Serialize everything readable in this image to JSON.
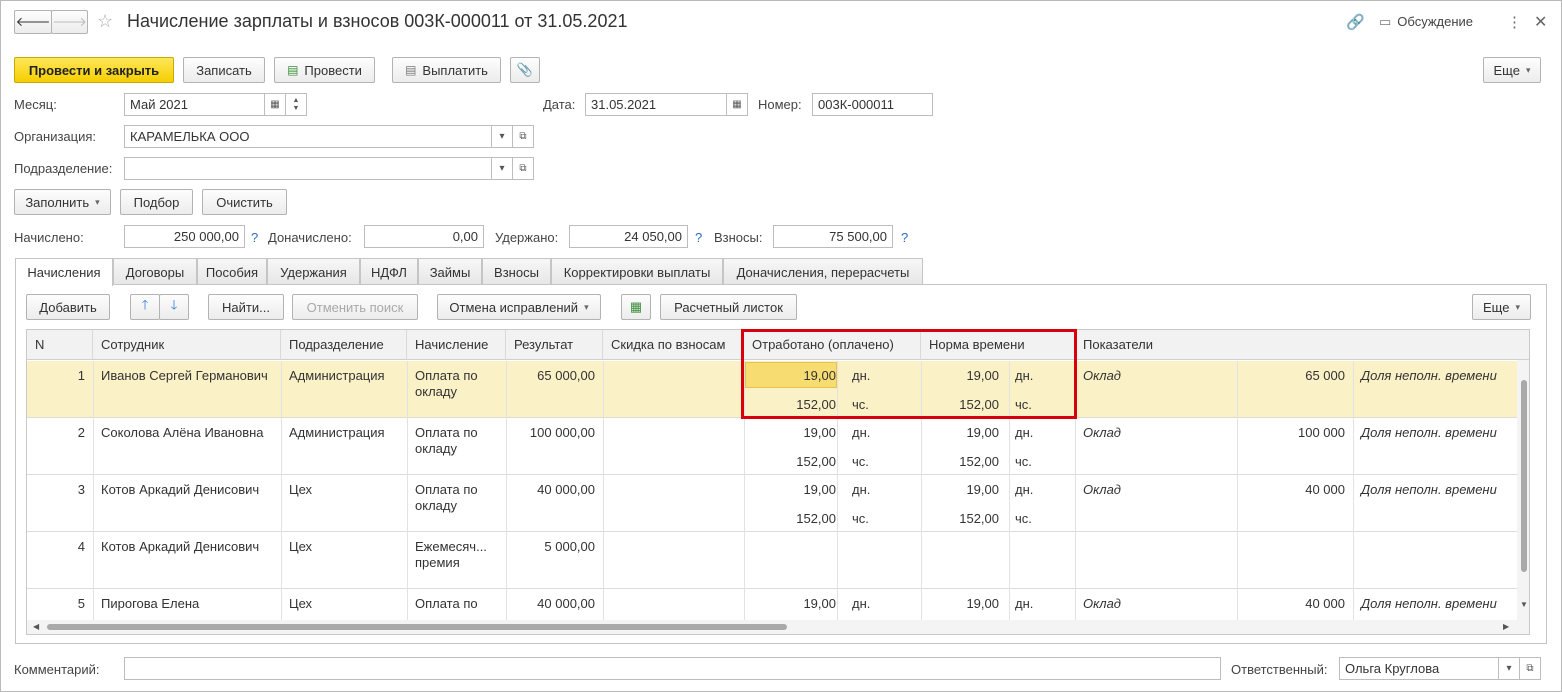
{
  "title": "Начисление зарплаты и взносов 003К-000011 от 31.05.2021",
  "window": {
    "discussion": "Обсуждение"
  },
  "toolbar": {
    "post_close": "Провести и закрыть",
    "save": "Записать",
    "post": "Провести",
    "pay": "Выплатить",
    "more": "Еще"
  },
  "header": {
    "month_label": "Месяц:",
    "month_value": "Май 2021",
    "date_label": "Дата:",
    "date_value": "31.05.2021",
    "number_label": "Номер:",
    "number_value": "003К-000011",
    "org_label": "Организация:",
    "org_value": "КАРАМЕЛЬКА ООО",
    "dept_label": "Подразделение:",
    "dept_value": ""
  },
  "actions": {
    "fill": "Заполнить",
    "select": "Подбор",
    "clear": "Очистить"
  },
  "totals": {
    "accrued_label": "Начислено:",
    "accrued_value": "250 000,00",
    "extra_label": "Доначислено:",
    "extra_value": "0,00",
    "withheld_label": "Удержано:",
    "withheld_value": "24 050,00",
    "contrib_label": "Взносы:",
    "contrib_value": "75 500,00",
    "help": "?"
  },
  "tabs": [
    "Начисления",
    "Договоры",
    "Пособия",
    "Удержания",
    "НДФЛ",
    "Займы",
    "Взносы",
    "Корректировки выплаты",
    "Доначисления, перерасчеты"
  ],
  "grid_toolbar": {
    "add": "Добавить",
    "find": "Найти...",
    "cancel_search": "Отменить поиск",
    "cancel_corrections": "Отмена исправлений",
    "payslip": "Расчетный листок",
    "more": "Еще"
  },
  "columns": [
    "N",
    "Сотрудник",
    "Подразделение",
    "Начисление",
    "Результат",
    "Скидка по взносам",
    "Отработано (оплачено)",
    "Норма времени",
    "Показатели"
  ],
  "rows": [
    {
      "n": "1",
      "employee": "Иванов Сергей Германович",
      "dept": "Администрация",
      "accrual1": "Оплата по",
      "accrual2": "окладу",
      "result": "65 000,00",
      "days": "19,00",
      "days_u": "дн.",
      "hours": "152,00",
      "hours_u": "чс.",
      "norm_days": "19,00",
      "norm_days_u": "дн.",
      "norm_hours": "152,00",
      "norm_hours_u": "чс.",
      "ind": "Оклад",
      "ind_val": "65 000",
      "ind2": "Доля неполн. времени"
    },
    {
      "n": "2",
      "employee": "Соколова Алёна Ивановна",
      "dept": "Администрация",
      "accrual1": "Оплата по",
      "accrual2": "окладу",
      "result": "100 000,00",
      "days": "19,00",
      "days_u": "дн.",
      "hours": "152,00",
      "hours_u": "чс.",
      "norm_days": "19,00",
      "norm_days_u": "дн.",
      "norm_hours": "152,00",
      "norm_hours_u": "чс.",
      "ind": "Оклад",
      "ind_val": "100 000",
      "ind2": "Доля неполн. времени"
    },
    {
      "n": "3",
      "employee": "Котов Аркадий Денисович",
      "dept": "Цех",
      "accrual1": "Оплата по",
      "accrual2": "окладу",
      "result": "40 000,00",
      "days": "19,00",
      "days_u": "дн.",
      "hours": "152,00",
      "hours_u": "чс.",
      "norm_days": "19,00",
      "norm_days_u": "дн.",
      "norm_hours": "152,00",
      "norm_hours_u": "чс.",
      "ind": "Оклад",
      "ind_val": "40 000",
      "ind2": "Доля неполн. времени"
    },
    {
      "n": "4",
      "employee": "Котов Аркадий Денисович",
      "dept": "Цех",
      "accrual1": "Ежемесяч...",
      "accrual2": "премия",
      "result": "5 000,00",
      "days": "",
      "days_u": "",
      "hours": "",
      "hours_u": "",
      "norm_days": "",
      "norm_days_u": "",
      "norm_hours": "",
      "norm_hours_u": "",
      "ind": "",
      "ind_val": "",
      "ind2": ""
    },
    {
      "n": "5",
      "employee": "Пирогова Елена",
      "dept": "Цех",
      "accrual1": "Оплата по",
      "accrual2": "",
      "result": "40 000,00",
      "days": "19,00",
      "days_u": "дн.",
      "hours": "",
      "hours_u": "",
      "norm_days": "19,00",
      "norm_days_u": "дн.",
      "norm_hours": "",
      "norm_hours_u": "",
      "ind": "Оклад",
      "ind_val": "40 000",
      "ind2": "Доля неполн. времени"
    }
  ],
  "footer": {
    "comment_label": "Комментарий:",
    "comment_value": "",
    "responsible_label": "Ответственный:",
    "responsible_value": "Ольга Круглова"
  },
  "colors": {
    "accent_yellow": "#f5cf00",
    "selected_row": "#fbf1c7",
    "highlight_box": "#d9000d",
    "help_blue": "#2b6cc4"
  }
}
